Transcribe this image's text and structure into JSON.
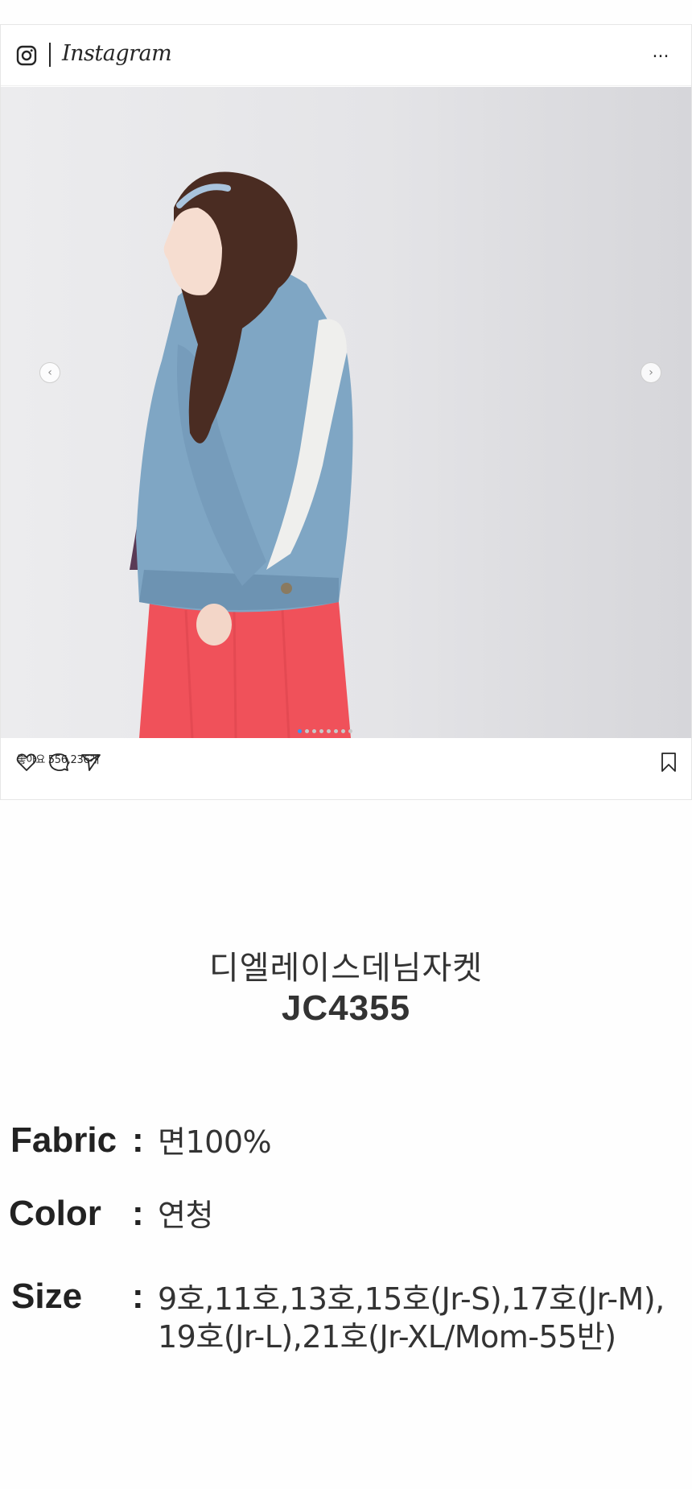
{
  "post": {
    "brand": "Instagram",
    "more_label": "...",
    "likes": "좋아요 556,236개",
    "dot_count": 8,
    "active_dot": 0
  },
  "product": {
    "name": "디엘레이스데님자켓",
    "code": "JC4355"
  },
  "specs": {
    "colon": ":",
    "fabric_label": "Fabric",
    "fabric_value": "면100%",
    "color_label": "Color",
    "color_value": "연청",
    "size_label": "Size",
    "size_value_line1": "9호,11호,13호,15호(Jr-S),17호(Jr-M),",
    "size_value_line2": "19호(Jr-L),21호(Jr-XL/Mom-55반)"
  },
  "icons": {
    "logo": "instagram-logo-icon",
    "like": "heart-icon",
    "comment": "comment-icon",
    "share": "paper-plane-icon",
    "save": "bookmark-icon",
    "prev": "chevron-left-icon",
    "next": "chevron-right-icon"
  },
  "colors": {
    "accent_dot": "#3897f0",
    "denim": "#7fa6c4",
    "skirt": "#f0515a"
  }
}
